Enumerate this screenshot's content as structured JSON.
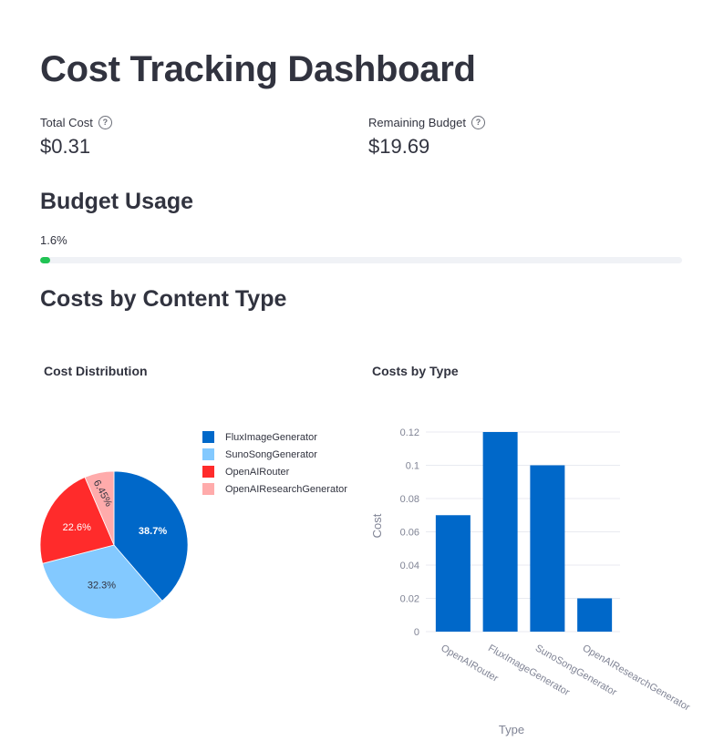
{
  "page": {
    "title": "Cost Tracking Dashboard"
  },
  "metrics": {
    "total_cost": {
      "label": "Total Cost",
      "value": "$0.31",
      "help_icon": "question-circle-icon"
    },
    "remaining_budget": {
      "label": "Remaining Budget",
      "value": "$19.69",
      "help_icon": "question-circle-icon"
    }
  },
  "budget": {
    "header": "Budget Usage",
    "percent_text": "1.6%",
    "progress_fraction": 0.016,
    "bar_color": "#21c354"
  },
  "content": {
    "header": "Costs by Content Type"
  },
  "chart_data": [
    {
      "type": "pie",
      "title": "Cost Distribution",
      "labels": [
        "FluxImageGenerator",
        "SunoSongGenerator",
        "OpenAIRouter",
        "OpenAIResearchGenerator"
      ],
      "values": [
        38.7,
        32.3,
        22.6,
        6.45
      ],
      "value_labels": [
        "38.7%",
        "32.3%",
        "22.6%",
        "6.45%"
      ],
      "colors": [
        "#0068c9",
        "#83c9ff",
        "#ff2b2b",
        "#ffabab"
      ],
      "legend": "right",
      "start_angle_deg": 0,
      "direction": "clockwise"
    },
    {
      "type": "bar",
      "title": "Costs by Type",
      "categories": [
        "OpenAIRouter",
        "FluxImageGenerator",
        "SunoSongGenerator",
        "OpenAIResearchGenerator"
      ],
      "values": [
        0.07,
        0.12,
        0.1,
        0.02
      ],
      "xlabel": "Type",
      "ylabel": "Cost",
      "ylim": [
        0,
        0.12
      ],
      "yticks": [
        0,
        0.02,
        0.04,
        0.06,
        0.08,
        0.1,
        0.12
      ],
      "ytick_labels": [
        "0",
        "0.02",
        "0.04",
        "0.06",
        "0.08",
        "0.1",
        "0.12"
      ],
      "bar_color": "#0068c9",
      "grid": true
    }
  ]
}
